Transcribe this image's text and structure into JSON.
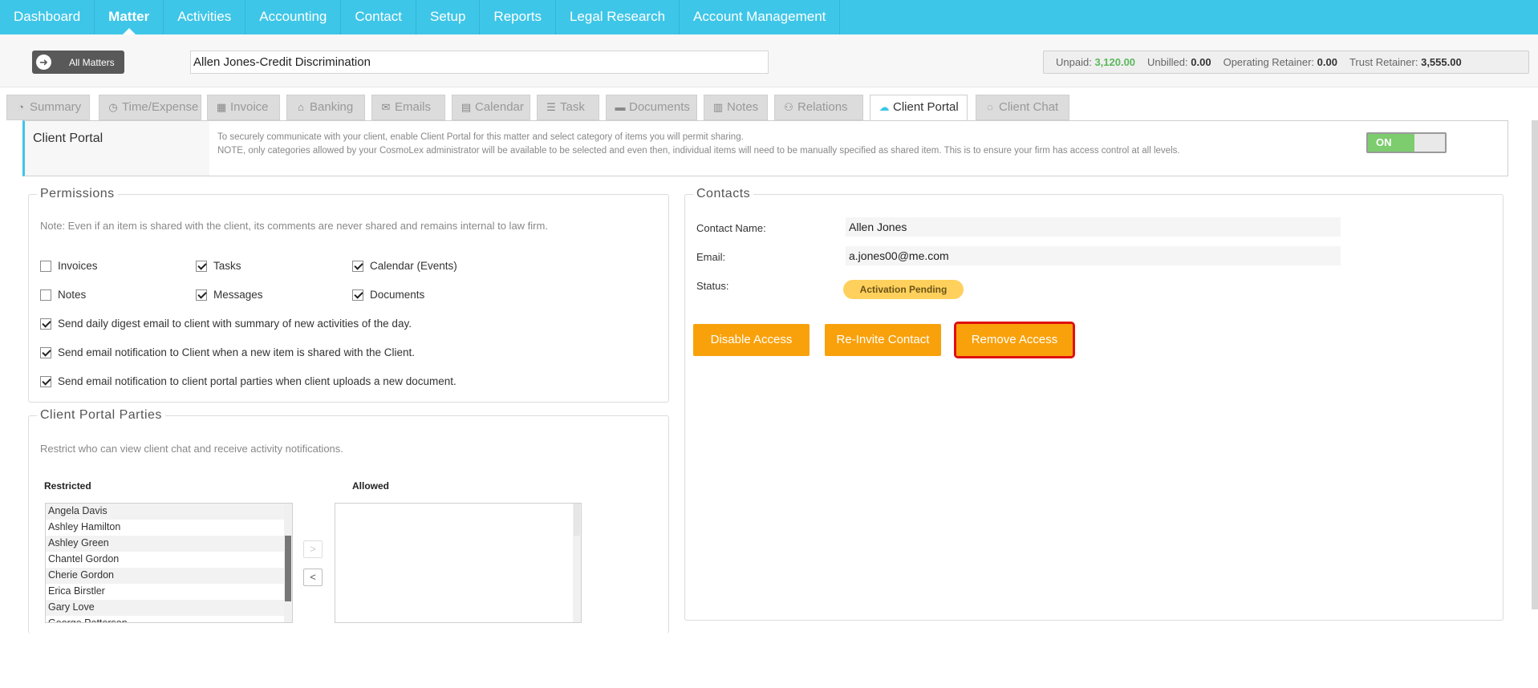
{
  "nav": {
    "items": [
      "Dashboard",
      "Matter",
      "Activities",
      "Accounting",
      "Contact",
      "Setup",
      "Reports",
      "Legal Research",
      "Account Management"
    ],
    "active": "Matter"
  },
  "header": {
    "all_matters_label": "All Matters",
    "matter_name": "Allen Jones-Credit Discrimination",
    "financials": {
      "unpaid_label": "Unpaid:",
      "unpaid_value": "3,120.00",
      "unbilled_label": "Unbilled:",
      "unbilled_value": "0.00",
      "operating_label": "Operating Retainer:",
      "operating_value": "0.00",
      "trust_label": "Trust Retainer:",
      "trust_value": "3,555.00"
    }
  },
  "tabs": [
    {
      "label": "Summary",
      "icon": "dashboard-icon"
    },
    {
      "label": "Time/Expense",
      "icon": "clock-icon"
    },
    {
      "label": "Invoice",
      "icon": "calculator-icon"
    },
    {
      "label": "Banking",
      "icon": "bank-icon"
    },
    {
      "label": "Emails",
      "icon": "envelope-icon"
    },
    {
      "label": "Calendar",
      "icon": "calendar-icon"
    },
    {
      "label": "Task",
      "icon": "tasks-icon"
    },
    {
      "label": "Documents",
      "icon": "folder-icon"
    },
    {
      "label": "Notes",
      "icon": "file-icon"
    },
    {
      "label": "Relations",
      "icon": "users-icon"
    },
    {
      "label": "Client Portal",
      "icon": "client-portal-icon"
    },
    {
      "label": "Client Chat",
      "icon": "chat-icon"
    }
  ],
  "portal": {
    "title": "Client Portal",
    "line1": "To securely communicate with your client, enable Client Portal for this matter and select category of items you will permit sharing.",
    "line2": "NOTE, only categories allowed by your CosmoLex administrator will be available to be selected and even then, individual items will need to be manually specified as shared item. This is to ensure your firm has access control at all levels.",
    "toggle_label": "ON"
  },
  "permissions": {
    "legend": "Permissions",
    "note": "Note: Even if an item is shared with the client, its comments are never shared and remains internal to law firm.",
    "items": [
      {
        "label": "Invoices",
        "checked": false
      },
      {
        "label": "Tasks",
        "checked": true
      },
      {
        "label": "Calendar (Events)",
        "checked": true
      },
      {
        "label": "Notes",
        "checked": false
      },
      {
        "label": "Messages",
        "checked": true
      },
      {
        "label": "Documents",
        "checked": true
      }
    ],
    "options": [
      {
        "label": "Send daily digest email to client with summary of new activities of the day.",
        "checked": true
      },
      {
        "label": "Send email notification to Client when a new item is shared with the Client.",
        "checked": true
      },
      {
        "label": "Send email notification to client portal parties when client uploads a new document.",
        "checked": true
      }
    ]
  },
  "parties": {
    "legend": "Client Portal Parties",
    "note": "Restrict who can view client chat and receive activity notifications.",
    "restricted_label": "Restricted",
    "allowed_label": "Allowed",
    "restricted": [
      "Angela Davis",
      "Ashley Hamilton",
      "Ashley Green",
      "Chantel Gordon",
      "Cherie Gordon",
      "Erica Birstler",
      "Gary Love",
      "George Patterson"
    ],
    "allowed": [],
    "move_right": ">",
    "move_left": "<"
  },
  "contacts": {
    "legend": "Contacts",
    "name_label": "Contact Name:",
    "name_value": "Allen Jones",
    "email_label": "Email:",
    "email_value": "a.jones00@me.com",
    "status_label": "Status:",
    "status_value": "Activation Pending",
    "buttons": {
      "disable": "Disable Access",
      "reinvite": "Re-Invite Contact",
      "remove": "Remove Access"
    }
  }
}
